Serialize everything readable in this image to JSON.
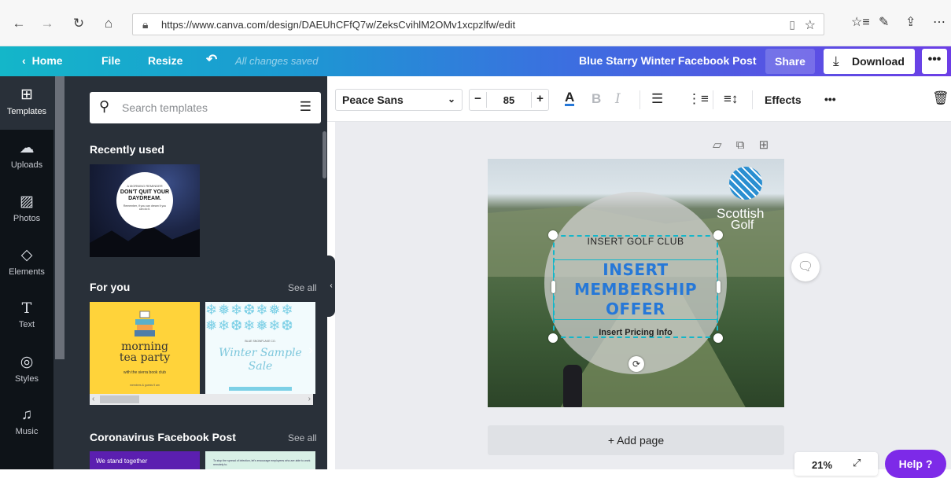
{
  "browser": {
    "url": "https://www.canva.com/design/DAEUhCFfQ7w/ZeksCvihlM2OMv1xcpzlfw/edit",
    "icons": [
      "back-arrow-icon",
      "forward-arrow-icon",
      "refresh-icon",
      "home-icon",
      "lock-icon",
      "reading-view-icon",
      "star-icon",
      "favorites-icon",
      "pen-icon",
      "share-icon",
      "more-icon"
    ]
  },
  "header": {
    "home_label": "Home",
    "file_label": "File",
    "resize_label": "Resize",
    "saved_status": "All changes saved",
    "design_title": "Blue Starry Winter Facebook Post",
    "share_label": "Share",
    "download_label": "Download",
    "more_label": "•••"
  },
  "leftnav": {
    "items": [
      {
        "label": "Templates",
        "icon": "templates-icon",
        "active": true
      },
      {
        "label": "Uploads",
        "icon": "cloud-upload-icon"
      },
      {
        "label": "Photos",
        "icon": "photo-icon"
      },
      {
        "label": "Elements",
        "icon": "shapes-icon"
      },
      {
        "label": "Text",
        "icon": "text-icon"
      },
      {
        "label": "Styles",
        "icon": "palette-icon"
      },
      {
        "label": "Music",
        "icon": "music-icon"
      }
    ]
  },
  "panel": {
    "search_placeholder": "Search templates",
    "recent_title": "Recently used",
    "foryou_title": "For you",
    "covid_title": "Coronavirus Facebook Post",
    "see_all": "See all",
    "daydream": {
      "small": "A MORNING REMINDER",
      "big": "DON'T QUIT YOUR DAYDREAM.",
      "sub": "Remember, if you can dream it you can do it."
    },
    "tea": {
      "title_line1": "morning",
      "title_line2": "tea party",
      "subtitle": "with the sierra book club",
      "footer": "members & guests 9 am"
    },
    "winter": {
      "small": "BLUE SNOWFLAKE CO.",
      "title_line1": "Winter Sample",
      "title_line2": "Sale"
    },
    "covid1": "We stand together",
    "covid2": "To stop the spread of infection, let's encourage employees who are able to work remotely to."
  },
  "toolbar": {
    "font_name": "Peace Sans",
    "font_size": "85",
    "decrease": "−",
    "increase": "+",
    "effects_label": "Effects",
    "more": "•••",
    "text_color": "#2678d8"
  },
  "design": {
    "club_text": "INSERT GOLF CLUB",
    "offer_line1": "INSERT",
    "offer_line2": "MEMBERSHIP",
    "offer_line3": "OFFER",
    "pricing_text": "Insert Pricing Info",
    "logo_line1": "Scottish",
    "logo_line2": "Golf"
  },
  "canvas": {
    "add_page_label": "+ Add page",
    "zoom": "21%",
    "help_label": "Help ?"
  },
  "colors": {
    "accent": "#14b6c9",
    "purple": "#7d2ae8",
    "sidebar": "#0e1318",
    "panel": "#293039"
  }
}
